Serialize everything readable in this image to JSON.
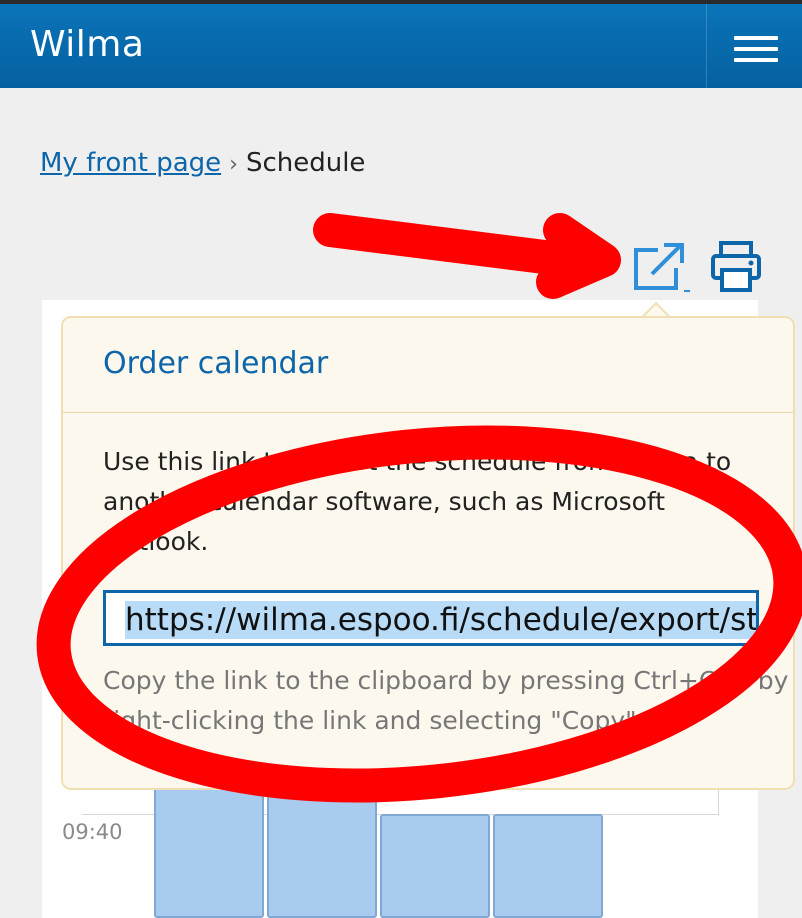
{
  "header": {
    "app_title": "Wilma"
  },
  "breadcrumb": {
    "home_label": "My front page",
    "separator": "›",
    "current_label": "Schedule"
  },
  "toolbar": {
    "export_icon": "external-link-icon",
    "print_icon": "printer-icon"
  },
  "popover": {
    "title": "Order calendar",
    "description": "Use this link to export the schedule from Wilma to another calendar software, such as Microsoft Outlook.",
    "link_value": "https://wilma.espoo.fi/schedule/export/st",
    "hint": "Copy the link to the clipboard by pressing Ctrl+C or by right-clicking the link and selecting \"Copy\"."
  },
  "schedule": {
    "time_label": "09:40"
  },
  "annotations": {
    "arrow_color": "#ff0000",
    "ellipse_color": "#ff0000"
  },
  "colors": {
    "brand": "#0a6db3",
    "accent": "#0d66aa",
    "popover_bg": "#fdf8ee",
    "event_block": "#a9cbef"
  }
}
